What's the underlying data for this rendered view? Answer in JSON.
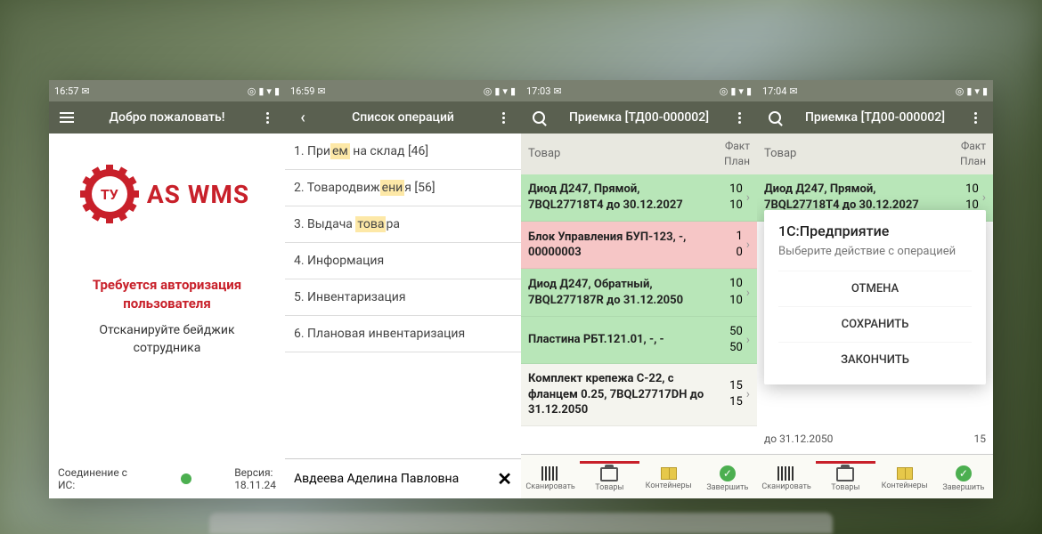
{
  "screen1": {
    "time": "16:57",
    "title": "Добро пожаловать!",
    "logo_text": "ТУ",
    "brand": "AS WMS",
    "auth_line1": "Требуется авторизация",
    "auth_line2": "пользователя",
    "scan_line1": "Отсканируйте бейджик",
    "scan_line2": "сотрудника",
    "conn_label": "Соединение с ИС:",
    "version_label": "Версия:",
    "version_value": "18.11.24"
  },
  "screen2": {
    "time": "16:59",
    "title": "Список операций",
    "items": [
      {
        "prefix": "1. При",
        "hl": "ем",
        "suffix": " на склад [46]"
      },
      {
        "prefix": "2. Товародвиж",
        "hl": "ени",
        "suffix": "я [56]"
      },
      {
        "prefix": "3. Выдача ",
        "hl": "това",
        "suffix": "ра"
      },
      {
        "prefix": "4. Информация",
        "hl": "",
        "suffix": ""
      },
      {
        "prefix": "5. Инвентаризация",
        "hl": "",
        "suffix": ""
      },
      {
        "prefix": "6. Плановая инвентаризация",
        "hl": "",
        "suffix": ""
      }
    ],
    "user": "Авдеева Аделина Павловна"
  },
  "screen3": {
    "time": "17:03",
    "title": "Приемка [ТД00-000002]",
    "col_name": "Товар",
    "col_fact": "Факт",
    "col_plan": "План",
    "rows": [
      {
        "name": "Диод Д247, Прямой, 7BQL27718T4 до 30.12.2027",
        "fact": "10",
        "plan": "10",
        "cls": "row-green"
      },
      {
        "name": "Блок Управления БУП-123, -, 00000003",
        "fact": "1",
        "plan": "0",
        "cls": "row-pink"
      },
      {
        "name": "Диод Д247, Обратный, 7BQL277187R до 31.12.2050",
        "fact": "10",
        "plan": "10",
        "cls": "row-green"
      },
      {
        "name": "Пластина РБТ.121.01, -, -",
        "fact": "50",
        "plan": "50",
        "cls": "row-green"
      },
      {
        "name": "Комплект крепежа С-22, с фланцем 0.25, 7BQL27717DH до 31.12.2050",
        "fact": "15",
        "plan": "15",
        "cls": "row-plain"
      }
    ],
    "nav": {
      "scan": "Сканировать",
      "goods": "Товары",
      "cont": "Контейнеры",
      "done": "Завершить"
    }
  },
  "screen4": {
    "time": "17:04",
    "title": "Приемка [ТД00-000002]",
    "col_name": "Товар",
    "col_fact": "Факт",
    "col_plan": "План",
    "row0": {
      "name": "Диод Д247, Прямой, 7BQL27718T4 до 30.12.2027",
      "fact": "10",
      "plan": "10"
    },
    "peek": {
      "text": "до 31.12.2050",
      "val": "15"
    },
    "modal": {
      "title": "1С:Предприятие",
      "sub": "Выберите действие с операцией",
      "cancel": "ОТМЕНА",
      "save": "СОХРАНИТЬ",
      "finish": "ЗАКОНЧИТЬ"
    },
    "nav": {
      "scan": "Сканировать",
      "goods": "Товары",
      "cont": "Контейнеры",
      "done": "Завершить"
    }
  }
}
